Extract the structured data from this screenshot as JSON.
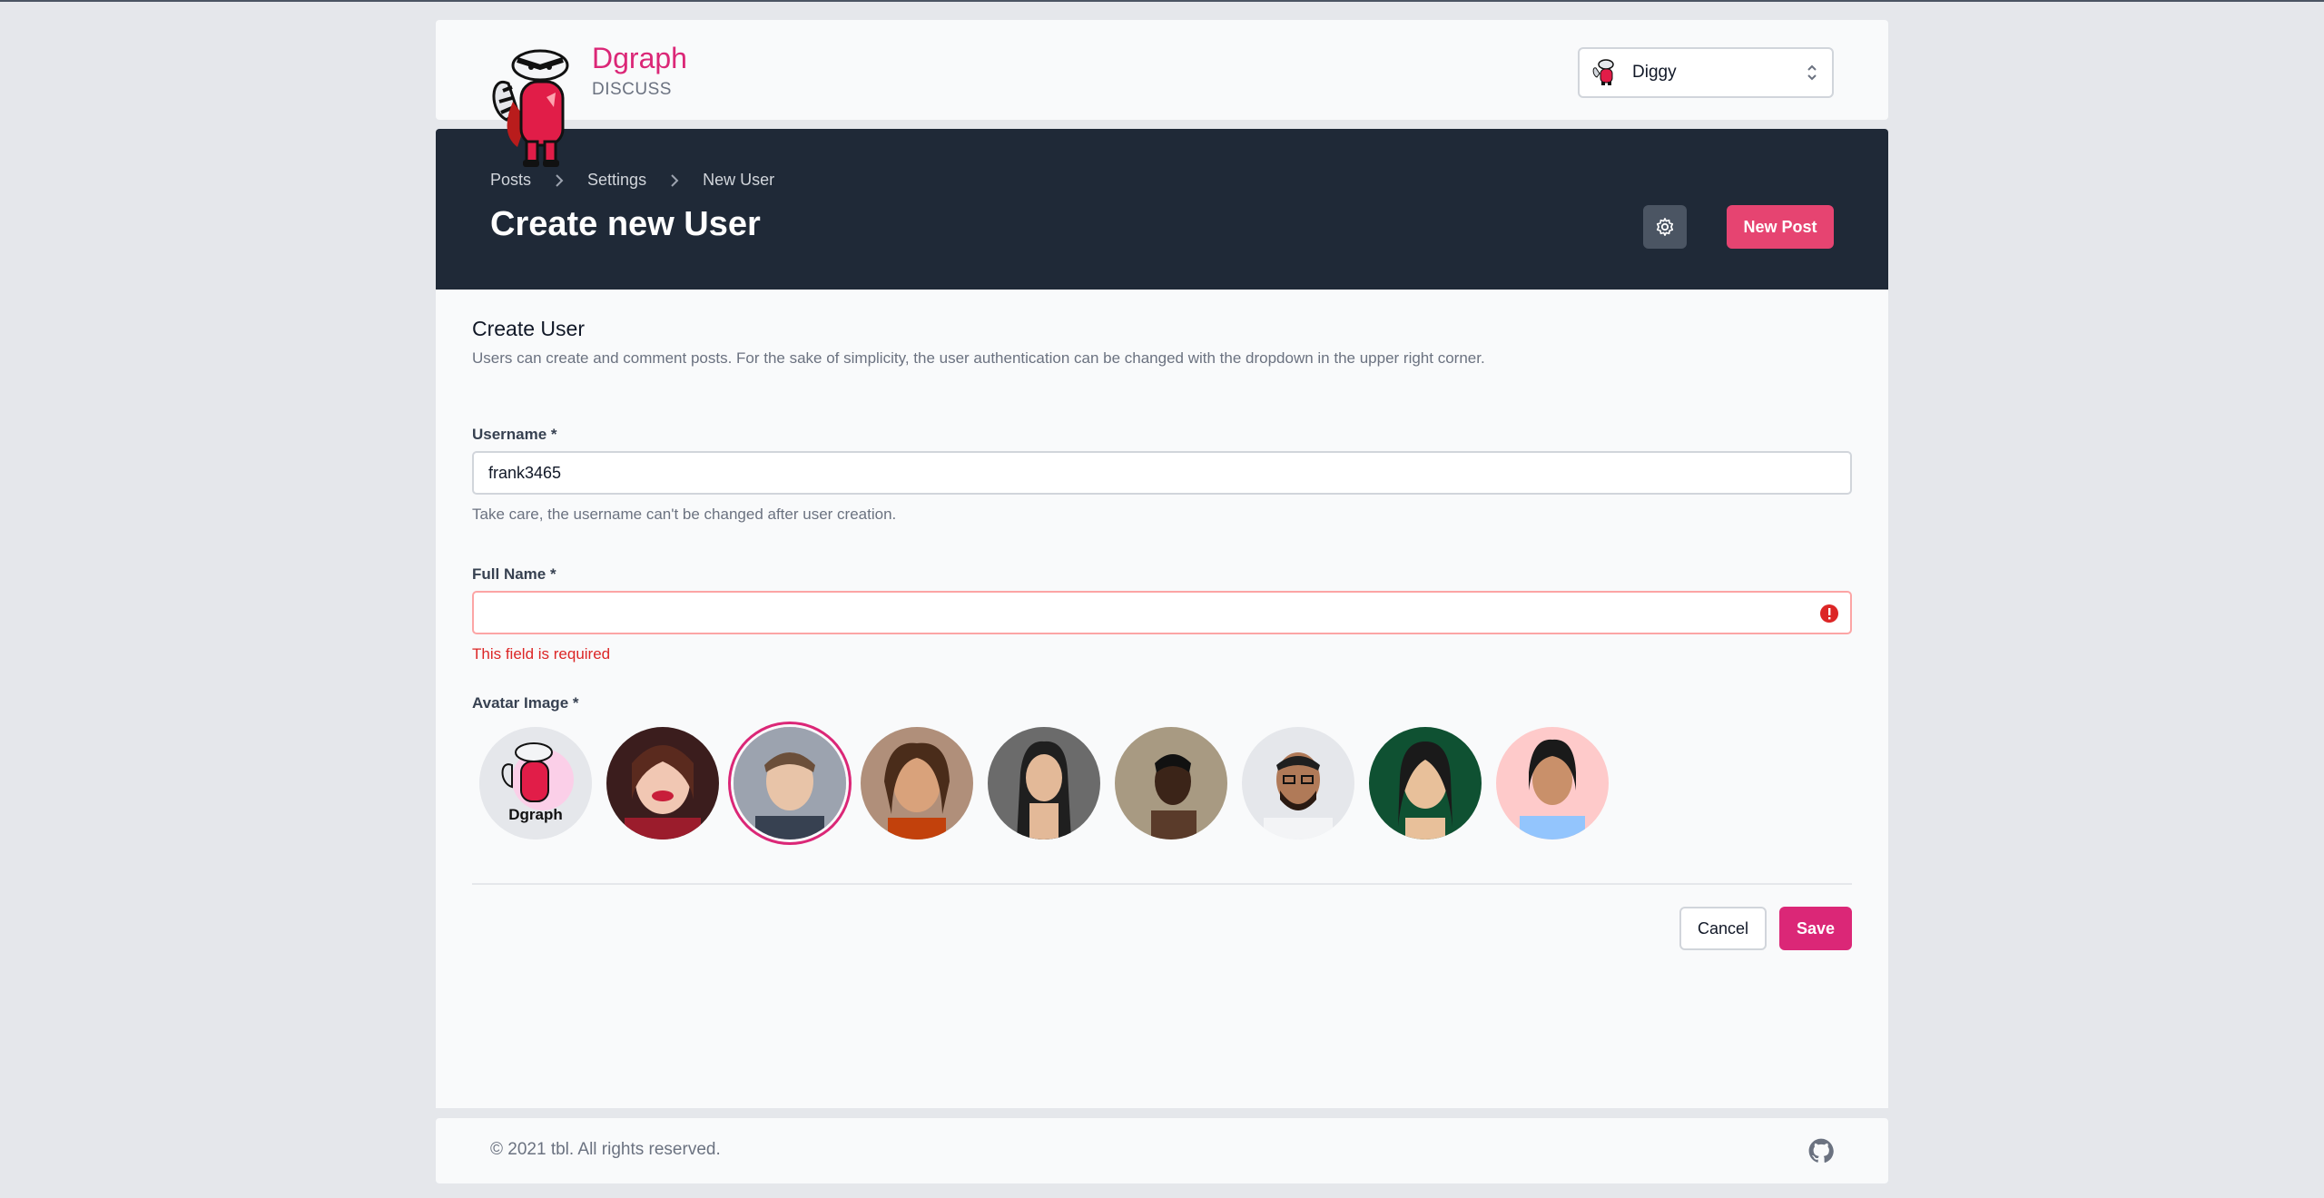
{
  "brand": {
    "name": "Dgraph",
    "sub": "DISCUSS",
    "icon": "badger-mascot-logo"
  },
  "user_select": {
    "value": "Diggy"
  },
  "breadcrumb": [
    "Posts",
    "Settings",
    "New User"
  ],
  "page_title": "Create new User",
  "actions": {
    "new_post": "New Post"
  },
  "form": {
    "title": "Create User",
    "description": "Users can create and comment posts. For the sake of simplicity, the user authentication can be changed with the dropdown in the upper right corner.",
    "username": {
      "label": "Username *",
      "value": "frank3465",
      "help": "Take care, the username can't be changed after user creation."
    },
    "fullname": {
      "label": "Full Name *",
      "value": "",
      "error": "This field is required"
    },
    "avatar": {
      "label": "Avatar Image *",
      "count": 9,
      "selected_index": 2,
      "first_caption": "Dgraph"
    },
    "cancel": "Cancel",
    "save": "Save"
  },
  "footer": {
    "copyright": "© 2021 tbl. All rights reserved."
  },
  "colors": {
    "accent": "#db2777",
    "dark": "#1f2937",
    "error": "#dc2626"
  }
}
